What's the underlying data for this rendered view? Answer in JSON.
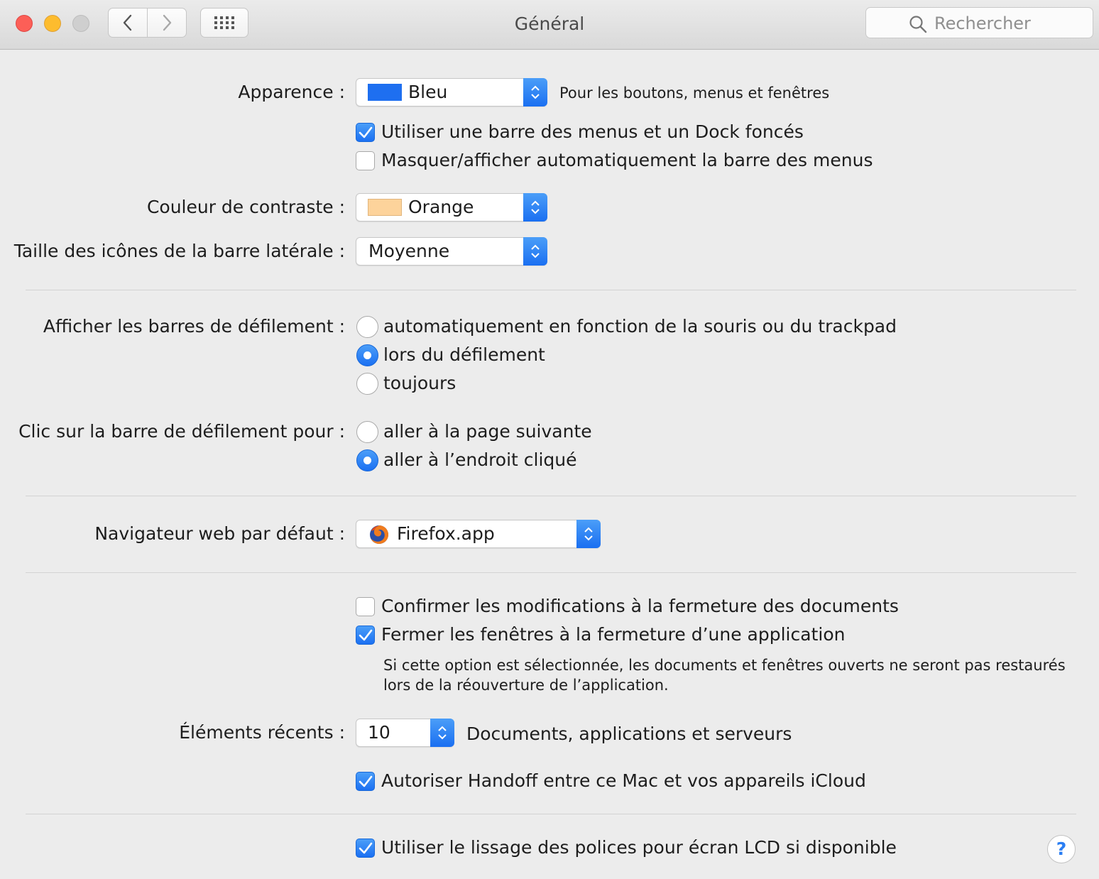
{
  "window": {
    "title": "Général",
    "search_placeholder": "Rechercher"
  },
  "appearance": {
    "label": "Apparence :",
    "value": "Bleu",
    "swatch_color": "#1e6ff0",
    "hint": "Pour les boutons, menus et fenêtres"
  },
  "dark_menu": {
    "label": "Utiliser une barre des menus et un Dock foncés",
    "checked": true
  },
  "autohide_menu": {
    "label": "Masquer/afficher automatiquement la barre des menus",
    "checked": false
  },
  "highlight": {
    "label": "Couleur de contraste :",
    "value": "Orange",
    "swatch_color": "#fdd39b"
  },
  "sidebar_size": {
    "label": "Taille des icônes de la barre latérale :",
    "value": "Moyenne"
  },
  "scrollbars": {
    "label": "Afficher les barres de défilement :",
    "options": [
      {
        "label": "automatiquement en fonction de la souris ou du trackpad",
        "selected": false
      },
      {
        "label": "lors du défilement",
        "selected": true
      },
      {
        "label": "toujours",
        "selected": false
      }
    ]
  },
  "scroll_click": {
    "label": "Clic sur la barre de défilement pour :",
    "options": [
      {
        "label": "aller à la page suivante",
        "selected": false
      },
      {
        "label": "aller à l’endroit cliqué",
        "selected": true
      }
    ]
  },
  "browser": {
    "label": "Navigateur web par défaut :",
    "value": "Firefox.app",
    "icon": "firefox-icon"
  },
  "confirm_changes": {
    "label": "Confirmer les modifications à la fermeture des documents",
    "checked": false
  },
  "close_windows": {
    "label": "Fermer les fenêtres à la fermeture d’une application",
    "checked": true,
    "note_line1": "Si cette option est sélectionnée, les documents et fenêtres ouverts ne seront pas restaurés",
    "note_line2": "lors de la réouverture de l’application."
  },
  "recent_items": {
    "label": "Éléments récents :",
    "value": "10",
    "hint": "Documents, applications et serveurs"
  },
  "handoff": {
    "label": "Autoriser Handoff entre ce Mac et vos appareils iCloud",
    "checked": true
  },
  "lcd_smoothing": {
    "label": "Utiliser le lissage des polices pour écran LCD si disponible",
    "checked": true
  },
  "help": {
    "label": "?"
  },
  "colors": {
    "accent": "#1b70f2",
    "window_bg": "#ececec"
  }
}
